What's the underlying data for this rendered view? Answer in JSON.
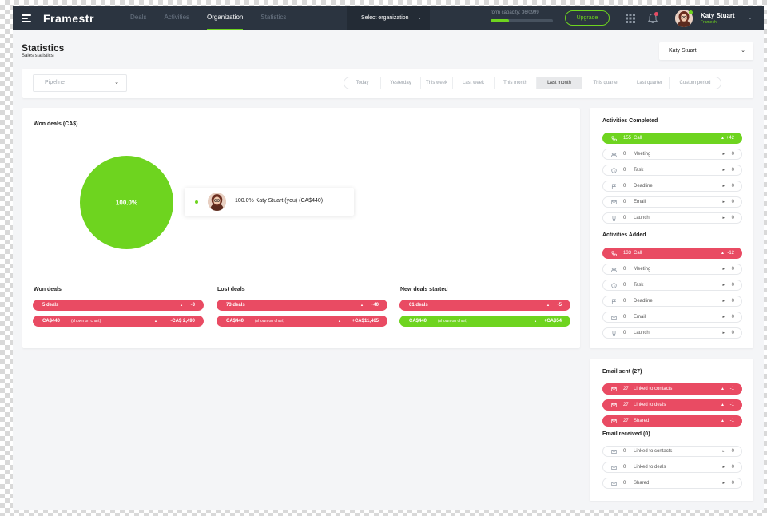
{
  "app": {
    "logo": "Framestr",
    "nav": [
      {
        "label": "Deals"
      },
      {
        "label": "Activities"
      },
      {
        "label": "Organization"
      },
      {
        "label": "Statistics"
      }
    ],
    "org_select_label": "Select organization",
    "capacity_label": "form capacity: 36/0999",
    "capacity_percent": 30,
    "upgrade_label": "Upgrade",
    "user": {
      "name": "Katy Stuart",
      "company": "Framech"
    }
  },
  "header": {
    "title": "Statistics",
    "subtitle": "Sales statistics",
    "user_dropdown": "Katy Stuart"
  },
  "filters": {
    "pipeline_placeholder": "Pipeline",
    "periods": [
      {
        "label": "Today",
        "active": false
      },
      {
        "label": "Yesterday",
        "active": false
      },
      {
        "label": "This week",
        "active": false
      },
      {
        "label": "Last week",
        "active": false
      },
      {
        "label": "This month",
        "active": false
      },
      {
        "label": "Last month",
        "active": true
      },
      {
        "label": "This quarter",
        "active": false
      },
      {
        "label": "Last quarter",
        "active": false
      },
      {
        "label": "Custom period",
        "active": false
      }
    ]
  },
  "won_chart": {
    "title": "Won deals (CA$)",
    "pie_label": "100.0%",
    "legend_text": "100.0% Katy Stuart (you) (CA$440)"
  },
  "chart_data": {
    "type": "pie",
    "title": "Won deals (CA$)",
    "slices": [
      {
        "label": "Katy Stuart (you)",
        "value": 440,
        "percent": 100.0,
        "color": "#6ed41f"
      }
    ]
  },
  "stats": [
    {
      "title": "Won deals",
      "rows": [
        {
          "left": "5 deals",
          "note": "",
          "right": "-3",
          "color": "red"
        },
        {
          "left": "CA$440",
          "note": "(shown on chart)",
          "right": "-CA$ 2,490",
          "color": "red"
        }
      ]
    },
    {
      "title": "Lost deals",
      "rows": [
        {
          "left": "73 deals",
          "note": "",
          "right": "+40",
          "color": "red"
        },
        {
          "left": "CA$440",
          "note": "(shown on chart)",
          "right": "+CA$11,465",
          "color": "red"
        }
      ]
    },
    {
      "title": "New deals started",
      "rows": [
        {
          "left": "61 deals",
          "note": "",
          "right": "-5",
          "color": "red"
        },
        {
          "left": "CA$440",
          "note": "(shown on chart)",
          "right": "+CA$54",
          "color": "green"
        }
      ]
    }
  ],
  "activities_completed": {
    "title": "Activities Completed",
    "rows": [
      {
        "icon": "phone-icon",
        "count": "155",
        "label": "Call",
        "delta": "+42",
        "color": "green"
      },
      {
        "icon": "meeting-icon",
        "count": "0",
        "label": "Meeting",
        "delta": "0",
        "color": "none"
      },
      {
        "icon": "clock-icon",
        "count": "0",
        "label": "Task",
        "delta": "0",
        "color": "none"
      },
      {
        "icon": "flag-icon",
        "count": "0",
        "label": "Deadline",
        "delta": "0",
        "color": "none"
      },
      {
        "icon": "mail-icon",
        "count": "0",
        "label": "Email",
        "delta": "0",
        "color": "none"
      },
      {
        "icon": "cup-icon",
        "count": "0",
        "label": "Launch",
        "delta": "0",
        "color": "none"
      }
    ]
  },
  "activities_added": {
    "title": "Activities Added",
    "rows": [
      {
        "icon": "phone-icon",
        "count": "133",
        "label": "Call",
        "delta": "-12",
        "color": "red"
      },
      {
        "icon": "meeting-icon",
        "count": "0",
        "label": "Meeting",
        "delta": "0",
        "color": "none"
      },
      {
        "icon": "clock-icon",
        "count": "0",
        "label": "Task",
        "delta": "0",
        "color": "none"
      },
      {
        "icon": "flag-icon",
        "count": "0",
        "label": "Deadline",
        "delta": "0",
        "color": "none"
      },
      {
        "icon": "mail-icon",
        "count": "0",
        "label": "Email",
        "delta": "0",
        "color": "none"
      },
      {
        "icon": "cup-icon",
        "count": "0",
        "label": "Launch",
        "delta": "0",
        "color": "none"
      }
    ]
  },
  "email_sent": {
    "title": "Email sent (27)",
    "rows": [
      {
        "icon": "mail-icon",
        "count": "27",
        "label": "Linked to contacts",
        "delta": "-1",
        "color": "red"
      },
      {
        "icon": "mail-icon",
        "count": "27",
        "label": "Linked to deals",
        "delta": "-1",
        "color": "red"
      },
      {
        "icon": "mail-icon",
        "count": "27",
        "label": "Shared",
        "delta": "-1",
        "color": "red"
      }
    ]
  },
  "email_received": {
    "title": "Email received (0)",
    "rows": [
      {
        "icon": "mail-icon",
        "count": "0",
        "label": "Linked to contacts",
        "delta": "0",
        "color": "none"
      },
      {
        "icon": "mail-icon",
        "count": "0",
        "label": "Linked to deals",
        "delta": "0",
        "color": "none"
      },
      {
        "icon": "mail-icon",
        "count": "0",
        "label": "Shared",
        "delta": "0",
        "color": "none"
      }
    ]
  },
  "colors": {
    "accent_green": "#6ed41f",
    "accent_red": "#e94b63",
    "nav_bg": "#2b3440"
  }
}
